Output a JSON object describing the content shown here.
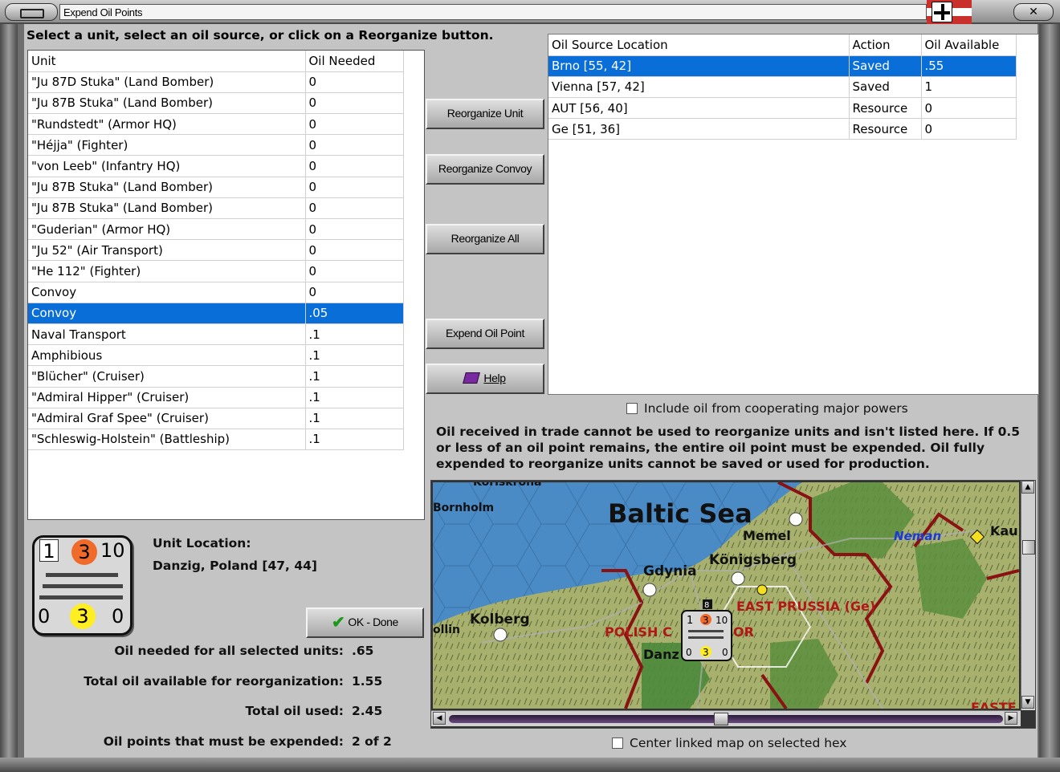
{
  "window": {
    "title": "Expend Oil Points",
    "close_label": "✕"
  },
  "prompt": "Select a unit, select an oil source, or click on a Reorganize button.",
  "unit_table": {
    "headers": [
      "Unit",
      "Oil Needed"
    ],
    "rows": [
      [
        "\"Ju 87D Stuka\" (Land Bomber)",
        "0"
      ],
      [
        "\"Ju 87B Stuka\" (Land Bomber)",
        "0"
      ],
      [
        "\"Rundstedt\" (Armor HQ)",
        "0"
      ],
      [
        "\"Héjja\" (Fighter)",
        "0"
      ],
      [
        "\"von Leeb\" (Infantry HQ)",
        "0"
      ],
      [
        "\"Ju 87B Stuka\" (Land Bomber)",
        "0"
      ],
      [
        "\"Ju 87B Stuka\" (Land Bomber)",
        "0"
      ],
      [
        "\"Guderian\" (Armor HQ)",
        "0"
      ],
      [
        "\"Ju 52\" (Air Transport)",
        "0"
      ],
      [
        "\"He 112\" (Fighter)",
        "0"
      ],
      [
        "Convoy",
        "0"
      ],
      [
        "Convoy",
        ".05"
      ],
      [
        "Naval Transport",
        ".1"
      ],
      [
        "Amphibious",
        ".1"
      ],
      [
        "\"Blücher\" (Cruiser)",
        ".1"
      ],
      [
        "\"Admiral Hipper\" (Cruiser)",
        ".1"
      ],
      [
        "\"Admiral Graf Spee\" (Cruiser)",
        ".1"
      ],
      [
        "\"Schleswig-Holstein\" (Battleship)",
        ".1"
      ]
    ],
    "selected_row": 11
  },
  "source_table": {
    "headers": [
      "Oil Source Location",
      "Action",
      "Oil Available"
    ],
    "rows": [
      [
        "Brno [55, 42]",
        "Saved",
        ".55"
      ],
      [
        "Vienna [57, 42]",
        "Saved",
        "1"
      ],
      [
        "AUT [56, 40]",
        "Resource",
        "0"
      ],
      [
        "Ge [51, 36]",
        "Resource",
        "0"
      ]
    ],
    "selected_row": 0
  },
  "buttons": {
    "reorganize_unit": "Reorganize Unit",
    "reorganize_convoy": "Reorganize Convoy",
    "reorganize_all": "Reorganize All",
    "expend_oil_point": "Expend Oil Point",
    "help": "Help",
    "ok_done": "OK - Done"
  },
  "checkboxes": {
    "cooperating": {
      "label": "Include oil from cooperating major powers",
      "checked": false
    },
    "center_map": {
      "label": "Center linked map on selected hex",
      "checked": false
    }
  },
  "note": "Oil received in trade cannot be used to reorganize units and isn't listed here.  If 0.5 or less of an oil point remains, the entire oil point must be expended.  Oil fully expended to reorganize units cannot be saved or used for production.",
  "unit_counter": {
    "top_left": "1",
    "top_mid": "3",
    "top_right": "10",
    "bottom_left": "0",
    "bottom_mid": "3",
    "bottom_right": "0"
  },
  "location": {
    "label": "Unit Location:",
    "value": "Danzig, Poland [47, 44]"
  },
  "stats": [
    {
      "label": "Oil needed for all selected units:",
      "value": ".65"
    },
    {
      "label": "Total oil available for reorganization:",
      "value": "1.55"
    },
    {
      "label": "Total oil used:",
      "value": "2.45"
    },
    {
      "label": "Oil points that must be expended:",
      "value": "2 of 2"
    }
  ],
  "map": {
    "sea_label": "Baltic Sea",
    "places": [
      "Bornholm",
      "Memel",
      "Königsberg",
      "Gdynia",
      "Kolberg",
      "Danz",
      "Neman",
      "Kau",
      "ollin",
      "EAST PRUSSIA (Ge)",
      "POLISH C",
      "OR",
      "EASTE",
      "Koriskrona"
    ],
    "counter": {
      "a": "1",
      "b": "3",
      "c": "10",
      "d": "0",
      "e": "3",
      "f": "0",
      "stack": "8"
    },
    "colors": {
      "sea": "#3d7fbd",
      "land": "#9cab6a",
      "border": "#8a1a1a",
      "forest": "#4f8a3a"
    }
  }
}
